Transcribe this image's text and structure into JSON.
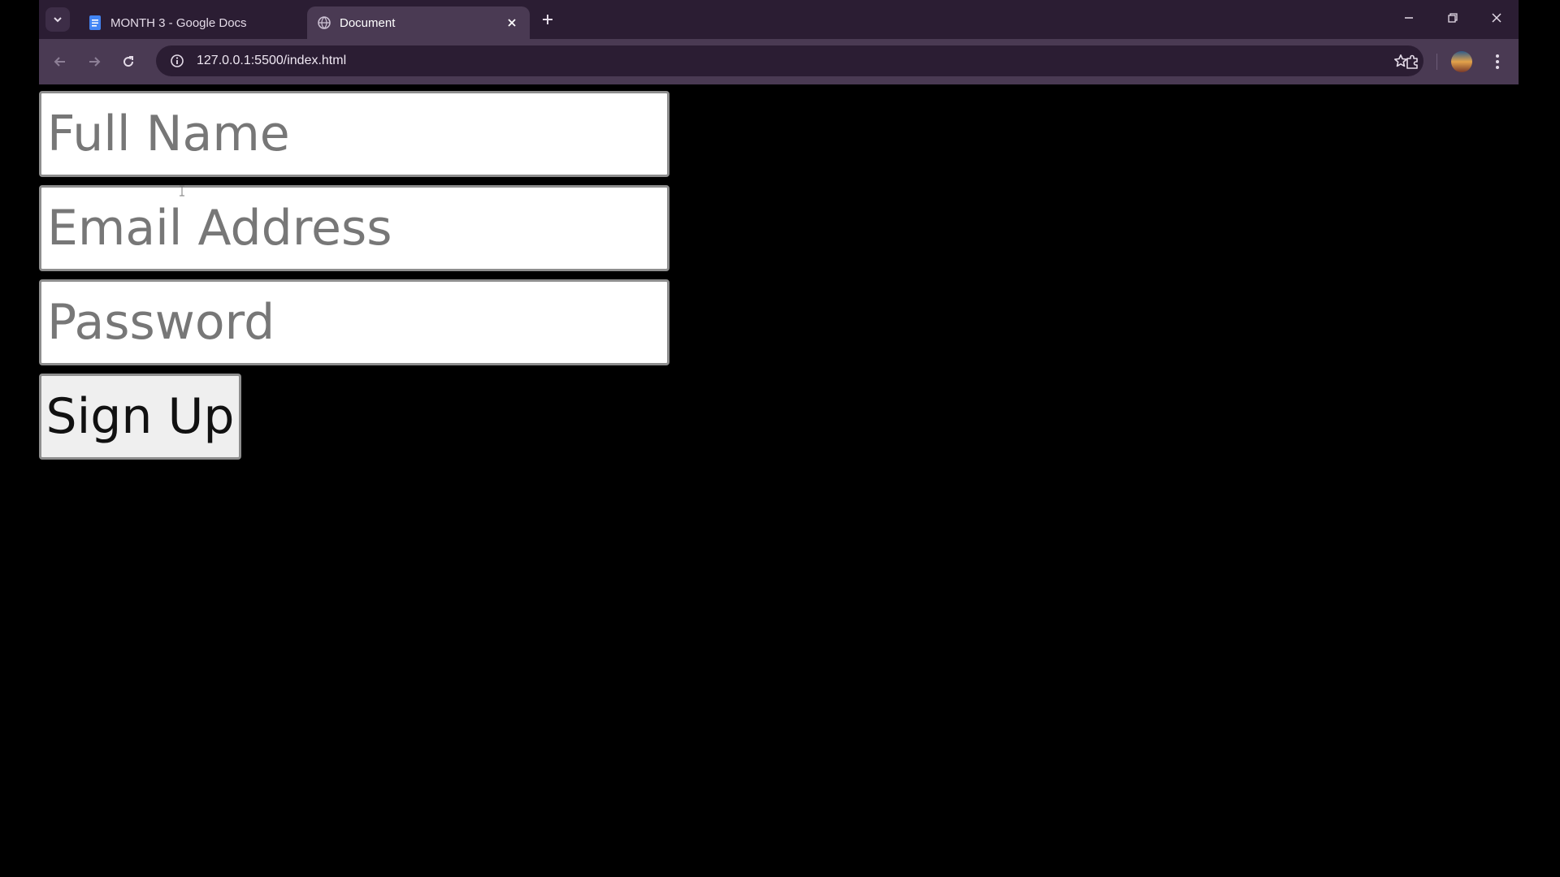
{
  "browser": {
    "tabs": [
      {
        "title": "MONTH 3 - Google Docs",
        "icon": "google-docs-icon",
        "active": false
      },
      {
        "title": "Document",
        "icon": "globe-icon",
        "active": true
      }
    ],
    "url": "127.0.0.1:5500/index.html"
  },
  "form": {
    "full_name_placeholder": "Full Name",
    "email_placeholder": "Email Address",
    "password_placeholder": "Password",
    "submit_label": "Sign Up"
  },
  "colors": {
    "tabstrip": "#2b1d33",
    "toolbar": "#4a3a53",
    "page_background": "#000000",
    "button_background": "#efefef"
  }
}
